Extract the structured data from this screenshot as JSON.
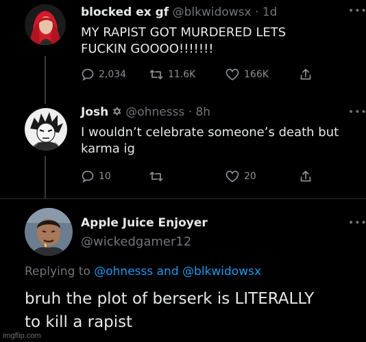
{
  "tweet1": {
    "name": "blocked ex gf",
    "handle": "@blkwidowsx",
    "time": "· 1d",
    "text_line1": "MY RAPIST GOT MURDERED LETS",
    "text_line2": "FUCKIN GOOOO!!!!!!!",
    "replies": "2,034",
    "retweets": "11.6K",
    "likes": "166K"
  },
  "tweet2": {
    "name": "Josh",
    "badge": "✡",
    "handle": "@ohnesss",
    "time": "· 8h",
    "text_line1": "I wouldn’t celebrate someone’s death but",
    "text_line2": "karma ig",
    "replies": "10",
    "retweets": "",
    "likes": "20"
  },
  "tweet3": {
    "name": "Apple Juice Enjoyer",
    "handle": "@wickedgamer12",
    "replying_prefix": "Replying to ",
    "mention1": "@ohnesss",
    "and_word": " and ",
    "mention2": "@blkwidowsx",
    "text_line1": "bruh the plot of berserk is LITERALLY",
    "text_line2": "to kill a rapist"
  },
  "more_glyph": "•••",
  "watermark": "imgflip.com",
  "colors": {
    "background": "#000000",
    "primary_text": "#e7e9ea",
    "secondary_text": "#71767b",
    "accent": "#1d9bf0"
  }
}
